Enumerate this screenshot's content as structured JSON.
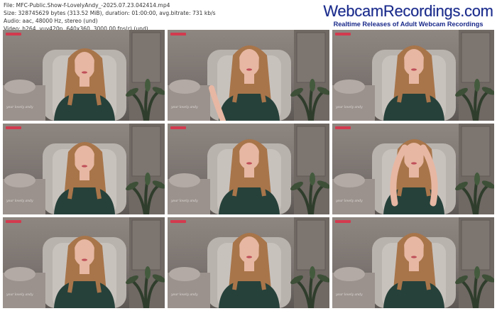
{
  "file_info": {
    "line1": "File: MFC-Public.Show-f-LovelyAndy_-2025.07.23.042414.mp4",
    "line2": "Size: 328745629 bytes (313.52 MiB), duration: 01:00:00, avg.bitrate: 731 kb/s",
    "line3": "Audio: aac, 48000 Hz, stereo (und)",
    "line4": "Video: h264, yuv420p, 640x360, 3000.00 fps(r) (und)"
  },
  "brand": {
    "name": "WebcamRecordings.com",
    "tagline": "Realtime Releases of Adult Webcam Recordings"
  },
  "frames": [
    {
      "handle": "your lovely andy",
      "pose": "down",
      "timestamp": ""
    },
    {
      "handle": "your lovely andy",
      "pose": "hand",
      "timestamp": ""
    },
    {
      "handle": "your lovely andy",
      "pose": "front",
      "timestamp": ""
    },
    {
      "handle": "your lovely andy",
      "pose": "down",
      "timestamp": ""
    },
    {
      "handle": "your lovely andy",
      "pose": "front",
      "timestamp": ""
    },
    {
      "handle": "your lovely andy",
      "pose": "arms-up",
      "timestamp": ""
    },
    {
      "handle": "your lovely andy",
      "pose": "down",
      "timestamp": ""
    },
    {
      "handle": "your lovely andy",
      "pose": "front",
      "timestamp": ""
    },
    {
      "handle": "your lovely andy",
      "pose": "front",
      "timestamp": ""
    }
  ],
  "colors": {
    "brand_blue": "#1a2a8a",
    "live_badge": "#d33a4e",
    "shirt": "#26413a",
    "hair": "#a8754a",
    "skin": "#e7b7a3"
  }
}
